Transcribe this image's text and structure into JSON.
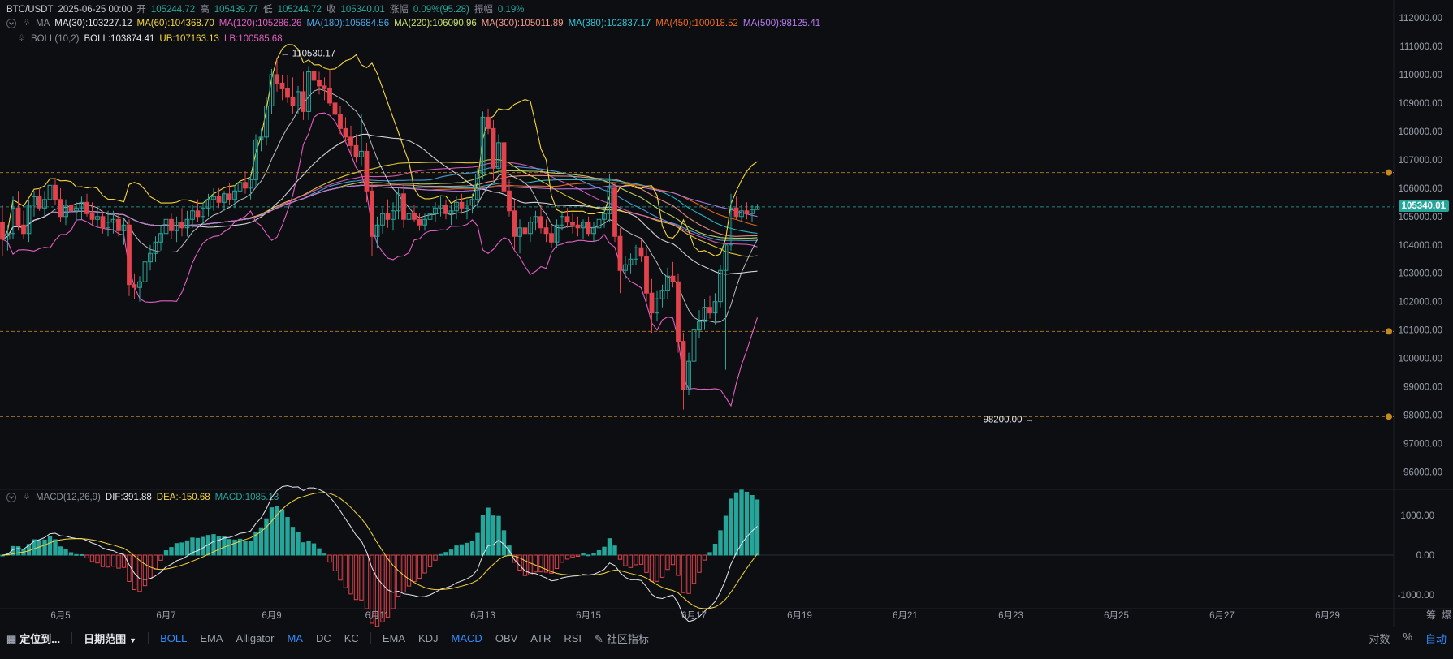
{
  "header": {
    "pair": "BTC/USDT",
    "datetime": "2025-06-25 00:00",
    "open_label": "开",
    "open": "105244.72",
    "high_label": "高",
    "high": "105439.77",
    "low_label": "低",
    "low": "105244.72",
    "close_label": "收",
    "close": "105340.01",
    "change_label": "涨幅",
    "change": "0.09%(95.28)",
    "amp_label": "振幅",
    "amp": "0.19%"
  },
  "ma_legend": {
    "title": "MA",
    "items": [
      {
        "text": "MA(30):103227.12",
        "color": "#e6e8ee"
      },
      {
        "text": "MA(60):104368.70",
        "color": "#f5d63d"
      },
      {
        "text": "MA(120):105286.26",
        "color": "#e15fc1"
      },
      {
        "text": "MA(180):105684.56",
        "color": "#4aa8e8"
      },
      {
        "text": "MA(220):106090.96",
        "color": "#c8e26b"
      },
      {
        "text": "MA(300):105011.89",
        "color": "#f59a8a"
      },
      {
        "text": "MA(380):102837.17",
        "color": "#2ec7d6"
      },
      {
        "text": "MA(450):100018.52",
        "color": "#f06b1e"
      },
      {
        "text": "MA(500):98125.41",
        "color": "#b77cf2"
      }
    ]
  },
  "boll_legend": {
    "title": "BOLL(10,2)",
    "items": [
      {
        "text": "BOLL:103874.41",
        "color": "#e6e8ee"
      },
      {
        "text": "UB:107163.13",
        "color": "#f5d63d"
      },
      {
        "text": "LB:100585.68",
        "color": "#e15fc1"
      }
    ]
  },
  "macd_legend": {
    "title": "MACD(12,26,9)",
    "items": [
      {
        "text": "DIF:391.88",
        "color": "#e6e8ee"
      },
      {
        "text": "DEA:-150.68",
        "color": "#f5d63d"
      },
      {
        "text": "MACD:1085.13",
        "color": "#26a69a"
      }
    ]
  },
  "price_tag": "105340.01",
  "toolbar": {
    "locate": "定位到...",
    "date_range": "日期范围",
    "main_indicators": [
      "BOLL",
      "EMA",
      "Alligator",
      "MA",
      "DC",
      "KC"
    ],
    "main_active": [
      "BOLL",
      "MA"
    ],
    "sub_indicators": [
      "EMA",
      "KDJ",
      "MACD",
      "OBV",
      "ATR",
      "RSI"
    ],
    "sub_active": [
      "MACD"
    ],
    "community": "社区指标",
    "right": [
      "对数",
      "%",
      "自动"
    ],
    "right_active": [
      "自动"
    ]
  },
  "right_edge_labels": [
    "筹",
    "爆"
  ],
  "chart_data": {
    "type": "candlestick",
    "pair": "BTC/USDT",
    "interval_note": "",
    "price_ticks": [
      112000,
      111000,
      110000,
      109000,
      108000,
      107000,
      106000,
      105000,
      104000,
      103000,
      102000,
      101000,
      100000,
      99000,
      98000,
      97000,
      96000
    ],
    "price_range": [
      95300,
      112400
    ],
    "x_labels": [
      "6月5",
      "6月7",
      "6月9",
      "6月11",
      "6月13",
      "6月15",
      "6月17",
      "6月19",
      "6月21",
      "6月23",
      "6月25",
      "6月27",
      "6月29"
    ],
    "x_label_bar_index": [
      11,
      31,
      51,
      71,
      91,
      111,
      131,
      151,
      171,
      191,
      211,
      231,
      251
    ],
    "max_bar": 260,
    "ohlc": [
      [
        104800,
        105400,
        103600,
        104200
      ],
      [
        104200,
        104700,
        103800,
        104400
      ],
      [
        104400,
        105700,
        104200,
        105300
      ],
      [
        105300,
        105900,
        104500,
        104700
      ],
      [
        104700,
        105200,
        104200,
        104400
      ],
      [
        104400,
        105600,
        104100,
        105400
      ],
      [
        105400,
        105900,
        105000,
        105700
      ],
      [
        105700,
        106000,
        105200,
        105300
      ],
      [
        105300,
        105900,
        105000,
        105600
      ],
      [
        105600,
        106500,
        105300,
        106100
      ],
      [
        106100,
        106300,
        105400,
        105600
      ],
      [
        105600,
        106000,
        104800,
        105000
      ],
      [
        105000,
        105600,
        104700,
        105400
      ],
      [
        105400,
        105900,
        105000,
        105200
      ],
      [
        105200,
        105500,
        104800,
        105300
      ],
      [
        105300,
        105700,
        104900,
        105500
      ],
      [
        105500,
        105800,
        105000,
        105100
      ],
      [
        105100,
        105500,
        104700,
        104900
      ],
      [
        104900,
        105300,
        104600,
        105000
      ],
      [
        105000,
        105200,
        104400,
        104600
      ],
      [
        104600,
        105200,
        104300,
        104800
      ],
      [
        104800,
        105200,
        104400,
        104900
      ],
      [
        104900,
        105100,
        104300,
        104500
      ],
      [
        104500,
        104900,
        104000,
        104700
      ],
      [
        104700,
        104900,
        102200,
        102600
      ],
      [
        102600,
        103000,
        102100,
        102500
      ],
      [
        102500,
        102900,
        102000,
        102700
      ],
      [
        102700,
        103600,
        102300,
        103400
      ],
      [
        103400,
        104000,
        103100,
        103700
      ],
      [
        103700,
        104300,
        103400,
        104100
      ],
      [
        104100,
        104700,
        103800,
        104400
      ],
      [
        104400,
        105200,
        104100,
        104900
      ],
      [
        104900,
        105100,
        104200,
        104500
      ],
      [
        104500,
        105000,
        104100,
        104800
      ],
      [
        104800,
        105300,
        104300,
        104600
      ],
      [
        104600,
        105200,
        104300,
        104900
      ],
      [
        104900,
        105400,
        104600,
        105200
      ],
      [
        105200,
        105600,
        104800,
        105000
      ],
      [
        105000,
        105500,
        104700,
        105300
      ],
      [
        105300,
        105800,
        105000,
        105600
      ],
      [
        105600,
        106000,
        105200,
        105700
      ],
      [
        105700,
        106000,
        105300,
        105500
      ],
      [
        105500,
        105900,
        105200,
        105800
      ],
      [
        105800,
        106200,
        105400,
        105600
      ],
      [
        105600,
        106100,
        105300,
        105900
      ],
      [
        105900,
        106400,
        105500,
        106200
      ],
      [
        106200,
        106600,
        105800,
        106000
      ],
      [
        106000,
        106500,
        105600,
        106300
      ],
      [
        106300,
        107900,
        106000,
        107700
      ],
      [
        107700,
        108100,
        107300,
        107800
      ],
      [
        107800,
        109200,
        107500,
        108900
      ],
      [
        108900,
        110200,
        108600,
        110000
      ],
      [
        110000,
        110530,
        109400,
        109700
      ],
      [
        109700,
        110000,
        109100,
        109500
      ],
      [
        109500,
        110000,
        109000,
        109200
      ],
      [
        109200,
        109900,
        108600,
        108900
      ],
      [
        108900,
        109600,
        108600,
        109400
      ],
      [
        109400,
        110100,
        108400,
        108700
      ],
      [
        108700,
        110300,
        108400,
        110100
      ],
      [
        110100,
        110300,
        109600,
        109800
      ],
      [
        109800,
        110100,
        109300,
        109600
      ],
      [
        109600,
        109900,
        109100,
        109500
      ],
      [
        109500,
        110200,
        108900,
        109000
      ],
      [
        109000,
        109500,
        108500,
        108600
      ],
      [
        108600,
        108900,
        107900,
        108100
      ],
      [
        108100,
        108500,
        107600,
        107800
      ],
      [
        107800,
        108200,
        107200,
        107500
      ],
      [
        107500,
        107900,
        106900,
        107100
      ],
      [
        107100,
        108600,
        106800,
        107300
      ],
      [
        107300,
        107600,
        105500,
        105900
      ],
      [
        105900,
        106200,
        103600,
        104300
      ],
      [
        104300,
        105000,
        103900,
        104700
      ],
      [
        104700,
        105300,
        104400,
        105100
      ],
      [
        105100,
        105600,
        104600,
        104900
      ],
      [
        104900,
        105500,
        104500,
        105200
      ],
      [
        105200,
        106000,
        104900,
        105800
      ],
      [
        105800,
        106100,
        104600,
        104900
      ],
      [
        104900,
        105300,
        104600,
        105100
      ],
      [
        105100,
        105400,
        104800,
        104900
      ],
      [
        104900,
        105100,
        104500,
        104700
      ],
      [
        104700,
        105100,
        104500,
        104900
      ],
      [
        104900,
        105300,
        104700,
        105100
      ],
      [
        105100,
        105500,
        104800,
        105300
      ],
      [
        105300,
        105700,
        105000,
        105400
      ],
      [
        105400,
        105600,
        104900,
        105100
      ],
      [
        105100,
        105400,
        104700,
        105200
      ],
      [
        105200,
        105700,
        104900,
        105500
      ],
      [
        105500,
        105800,
        105100,
        105300
      ],
      [
        105300,
        105600,
        104900,
        105400
      ],
      [
        105400,
        105800,
        105100,
        105600
      ],
      [
        105600,
        106700,
        105300,
        106500
      ],
      [
        106500,
        108700,
        106300,
        108500
      ],
      [
        108500,
        108800,
        107900,
        108100
      ],
      [
        108100,
        108400,
        106300,
        106700
      ],
      [
        106700,
        107900,
        106500,
        107600
      ],
      [
        107600,
        107800,
        105600,
        105900
      ],
      [
        105900,
        106300,
        105000,
        105200
      ],
      [
        105200,
        105600,
        103800,
        104300
      ],
      [
        104300,
        104900,
        103700,
        104600
      ],
      [
        104600,
        104900,
        104200,
        104400
      ],
      [
        104400,
        105000,
        104100,
        104800
      ],
      [
        104800,
        105200,
        104500,
        105000
      ],
      [
        105000,
        105400,
        104400,
        104600
      ],
      [
        104600,
        104900,
        104100,
        104400
      ],
      [
        104400,
        104700,
        103900,
        104100
      ],
      [
        104100,
        104900,
        103900,
        104700
      ],
      [
        104700,
        105200,
        104500,
        105000
      ],
      [
        105000,
        105300,
        104600,
        104800
      ],
      [
        104800,
        105100,
        104400,
        104700
      ],
      [
        104700,
        105000,
        104300,
        104600
      ],
      [
        104600,
        104900,
        104200,
        104800
      ],
      [
        104800,
        105000,
        104300,
        104400
      ],
      [
        104400,
        104800,
        104100,
        104600
      ],
      [
        104600,
        105000,
        104400,
        104900
      ],
      [
        104900,
        105300,
        104600,
        105100
      ],
      [
        105100,
        106500,
        104800,
        106000
      ],
      [
        106000,
        106200,
        104100,
        104300
      ],
      [
        104300,
        104600,
        102300,
        103100
      ],
      [
        103100,
        103600,
        102800,
        103300
      ],
      [
        103300,
        103700,
        103000,
        103500
      ],
      [
        103500,
        104000,
        103300,
        103900
      ],
      [
        103900,
        104200,
        103400,
        103600
      ],
      [
        103600,
        103900,
        102000,
        102300
      ],
      [
        102300,
        102800,
        100900,
        101600
      ],
      [
        101600,
        102400,
        101300,
        102100
      ],
      [
        102100,
        102600,
        101800,
        102400
      ],
      [
        102400,
        103200,
        102100,
        102900
      ],
      [
        102900,
        103400,
        102500,
        102700
      ],
      [
        102700,
        103000,
        100200,
        100600
      ],
      [
        100600,
        100900,
        98200,
        98900
      ],
      [
        98900,
        100200,
        98700,
        99900
      ],
      [
        99900,
        101300,
        99600,
        101000
      ],
      [
        101000,
        101700,
        100700,
        101300
      ],
      [
        101300,
        102100,
        101000,
        101800
      ],
      [
        101800,
        102200,
        101400,
        101600
      ],
      [
        101600,
        102300,
        101200,
        102000
      ],
      [
        102000,
        103300,
        101800,
        103100
      ],
      [
        103100,
        104000,
        99600,
        104000
      ],
      [
        104000,
        105800,
        103800,
        105300
      ],
      [
        105300,
        105700,
        104900,
        105000
      ],
      [
        105000,
        105400,
        104800,
        105200
      ],
      [
        105200,
        105500,
        104900,
        105100
      ],
      [
        105100,
        105400,
        104800,
        105244.72
      ],
      [
        105244.72,
        105439.77,
        105244.72,
        105340.01
      ]
    ],
    "annotations": [
      {
        "text": "110530.17",
        "bar": 52,
        "price": 110530.17
      },
      {
        "text": "98200.00",
        "bar": 195,
        "price": 98200
      }
    ],
    "horizontal_lines": [
      {
        "price": 106550,
        "color": "#c58a1e"
      },
      {
        "price": 100950,
        "color": "#c58a1e"
      },
      {
        "price": 97950,
        "color": "#c58a1e"
      },
      {
        "price": 105340.01,
        "color": "#26a69a"
      }
    ],
    "macd": {
      "ticks": [
        1000,
        0,
        -1000
      ],
      "range": [
        -1300,
        1300
      ]
    }
  }
}
